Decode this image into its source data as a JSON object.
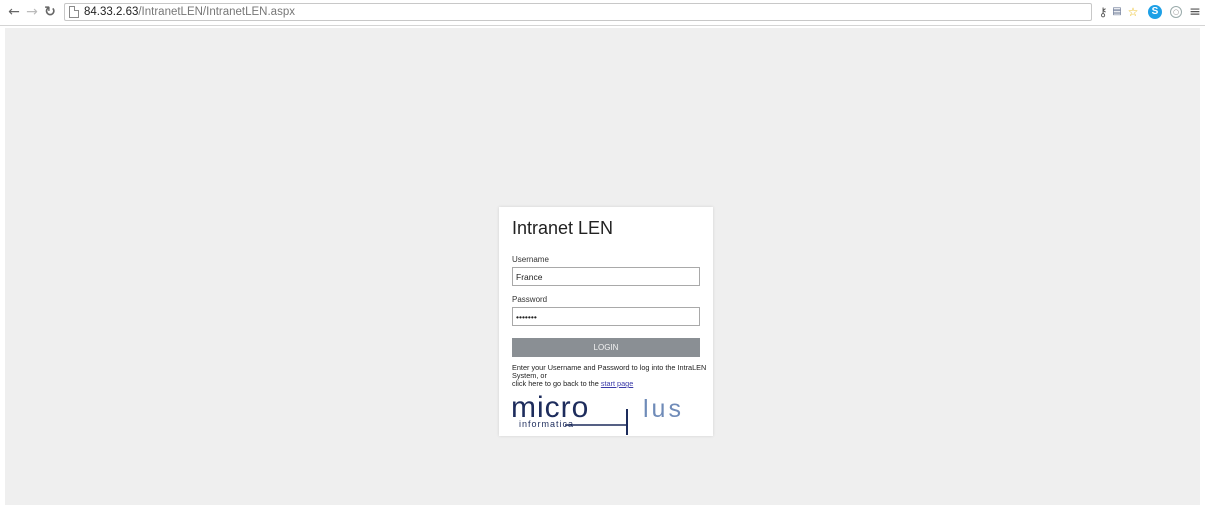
{
  "browser": {
    "url_host": "84.33.2.63",
    "url_path": "/IntranetLEN/IntranetLEN.aspx",
    "skype_icon_letter": "S"
  },
  "login": {
    "title": "Intranet LEN",
    "username_label": "Username",
    "username_value": "France",
    "password_label": "Password",
    "password_value": "•••••••",
    "button_label": "LOGIN",
    "help_line1": "Enter your Username and Password to log into the IntraLEN System, or",
    "help_line2_prefix": "click here to go back to the ",
    "help_link": "start page"
  },
  "logo": {
    "part1": "micro",
    "part2": "lus",
    "tagline": "informatica",
    "color_dark": "#1d2c5c",
    "color_light": "#6f8bb8"
  },
  "colors": {
    "page_bg": "#efefef",
    "button_bg": "#8a8f94"
  }
}
